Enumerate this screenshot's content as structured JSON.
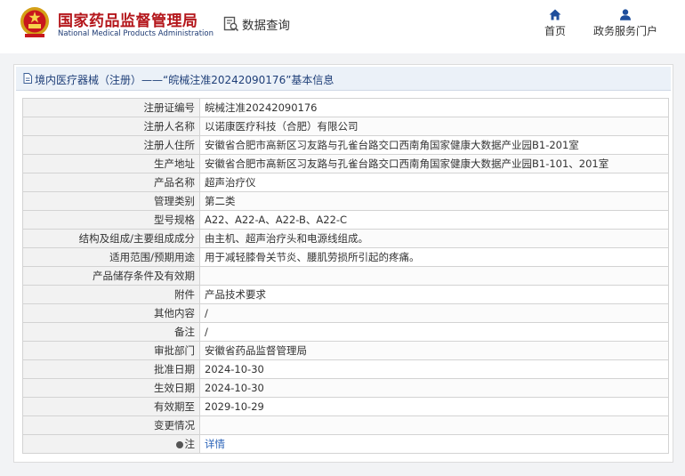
{
  "header": {
    "site_name_cn": "国家药品监督管理局",
    "site_name_en": "National Medical Products Administration",
    "data_query": "数据查询",
    "nav": [
      {
        "label": "首页",
        "icon": "home-icon"
      },
      {
        "label": "政务服务门户",
        "icon": "user-icon"
      }
    ]
  },
  "panel": {
    "title": "境内医疗器械（注册）——“皖械注准20242090176”基本信息"
  },
  "rows": [
    {
      "key": "注册证编号",
      "value": "皖械注准20242090176"
    },
    {
      "key": "注册人名称",
      "value": "以诺康医疗科技（合肥）有限公司"
    },
    {
      "key": "注册人住所",
      "value": "安徽省合肥市高新区习友路与孔雀台路交口西南角国家健康大数据产业园B1-201室"
    },
    {
      "key": "生产地址",
      "value": "安徽省合肥市高新区习友路与孔雀台路交口西南角国家健康大数据产业园B1-101、201室"
    },
    {
      "key": "产品名称",
      "value": "超声治疗仪"
    },
    {
      "key": "管理类别",
      "value": "第二类"
    },
    {
      "key": "型号规格",
      "value": "A22、A22-A、A22-B、A22-C"
    },
    {
      "key": "结构及组成/主要组成成分",
      "value": "由主机、超声治疗头和电源线组成。"
    },
    {
      "key": "适用范围/预期用途",
      "value": "用于减轻膝骨关节炎、腰肌劳损所引起的疼痛。"
    },
    {
      "key": "产品储存条件及有效期",
      "value": ""
    },
    {
      "key": "附件",
      "value": "产品技术要求"
    },
    {
      "key": "其他内容",
      "value": "/"
    },
    {
      "key": "备注",
      "value": "/"
    },
    {
      "key": "审批部门",
      "value": "安徽省药品监督管理局"
    },
    {
      "key": "批准日期",
      "value": "2024-10-30"
    },
    {
      "key": "生效日期",
      "value": "2024-10-30"
    },
    {
      "key": "有效期至",
      "value": "2029-10-29"
    },
    {
      "key": "变更情况",
      "value": ""
    },
    {
      "key": "注",
      "value": "详情"
    }
  ]
}
